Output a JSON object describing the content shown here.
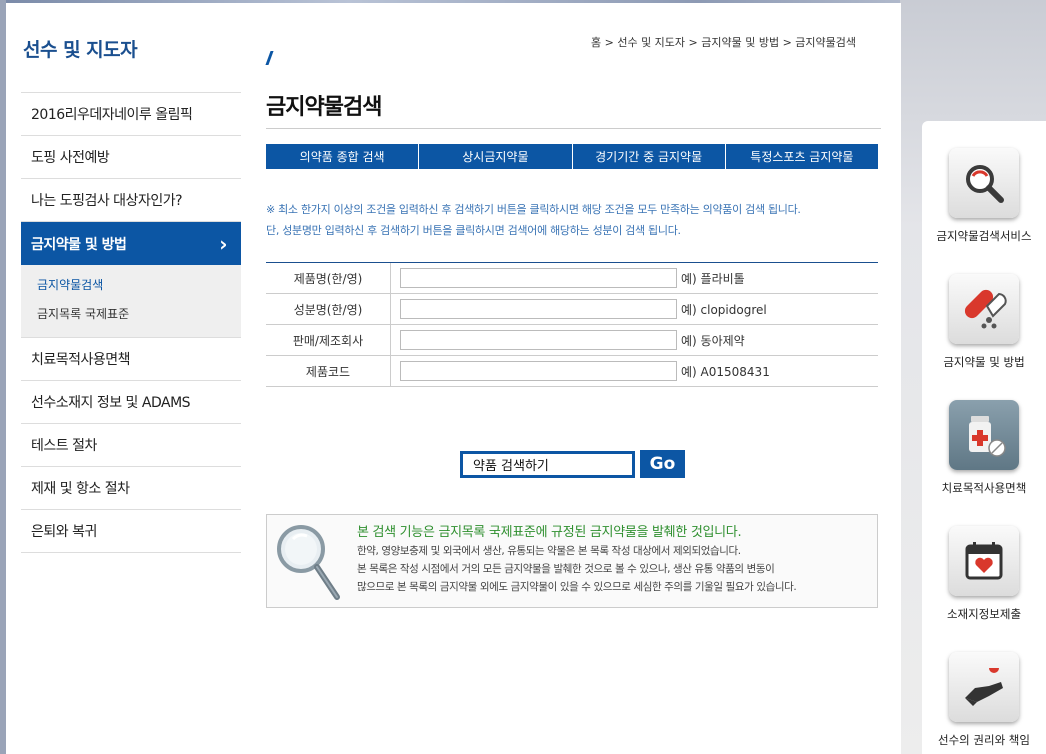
{
  "breadcrumb": "홈 > 선수 및 지도자 > 금지약물 및 방법 > 금지약물검색",
  "sidebar": {
    "title": "선수 및 지도자",
    "items": [
      {
        "label": "2016리우데자네이루 올림픽"
      },
      {
        "label": "도핑 사전예방"
      },
      {
        "label": "나는 도핑검사 대상자인가?"
      },
      {
        "label": "금지약물 및 방법",
        "active": true
      },
      {
        "label": "치료목적사용면책"
      },
      {
        "label": "선수소재지 정보 및 ADAMS"
      },
      {
        "label": "테스트 절차"
      },
      {
        "label": "제재 및 항소 절차"
      },
      {
        "label": "은퇴와 복귀"
      }
    ],
    "active_arrow": "›",
    "subitems": [
      {
        "label": "금지약물검색",
        "current": true
      },
      {
        "label": "금지목록 국제표준"
      }
    ]
  },
  "main": {
    "title": "금지약물검색",
    "tabs": [
      {
        "label": "의약품 종합 검색"
      },
      {
        "label": "상시금지약물"
      },
      {
        "label": "경기기간 중 금지약물"
      },
      {
        "label": "특정스포츠 금지약물"
      }
    ],
    "note_line1": "※ 최소 한가지 이상의 조건을 입력하신 후 검색하기 버튼을 클릭하시면 해당 조건을 모두 만족하는 의약품이 검색 됩니다.",
    "note_line2": "단, 성분명만 입력하신 후 검색하기 버튼을 클릭하시면 검색어에 해당하는 성분이 검색 됩니다.",
    "form": [
      {
        "label": "제품명(한/영)",
        "value": "",
        "example": "예) 플라비톨"
      },
      {
        "label": "성분명(한/영)",
        "value": "",
        "example": "예) clopidogrel"
      },
      {
        "label": "판매/제조회사",
        "value": "",
        "example": "예) 동아제약"
      },
      {
        "label": "제품코드",
        "value": "",
        "example": "예) A01508431"
      }
    ],
    "search_box": "약품 검색하기",
    "go_label": "Go",
    "info": {
      "head": "본 검색 기능은 금지목록 국제표준에 규정된 금지약물을 발췌한 것입니다.",
      "line1": "한약, 영양보충제 및 외국에서 생산, 유통되는 약물은 본 목록 작성 대상에서 제외되었습니다.",
      "line2": "본 목록은 작성 시점에서 거의 모든 금지약물을 발췌한 것으로 볼 수 있으나, 생산 유통 약품의 변동이",
      "line3": "많으므로 본 목록의 금지약물 외에도 금지약물이 있을 수 있으므로 세심한 주의를 기울일 필요가 있습니다."
    }
  },
  "quick_menu": [
    {
      "label": "금지약물검색서비스",
      "icon": "magnifier-icon"
    },
    {
      "label": "금지약물 및 방법",
      "icon": "pill-capsule-icon"
    },
    {
      "label": "치료목적사용면책",
      "icon": "medicine-bottle-icon"
    },
    {
      "label": "소재지정보제출",
      "icon": "calendar-heart-icon"
    },
    {
      "label": "선수의 권리와 책임",
      "icon": "hand-heart-icon"
    }
  ],
  "colors": {
    "primary": "#0c56a4",
    "title": "#1a4f8f",
    "info_head": "#2f8f2f",
    "note": "#3a74b5"
  }
}
